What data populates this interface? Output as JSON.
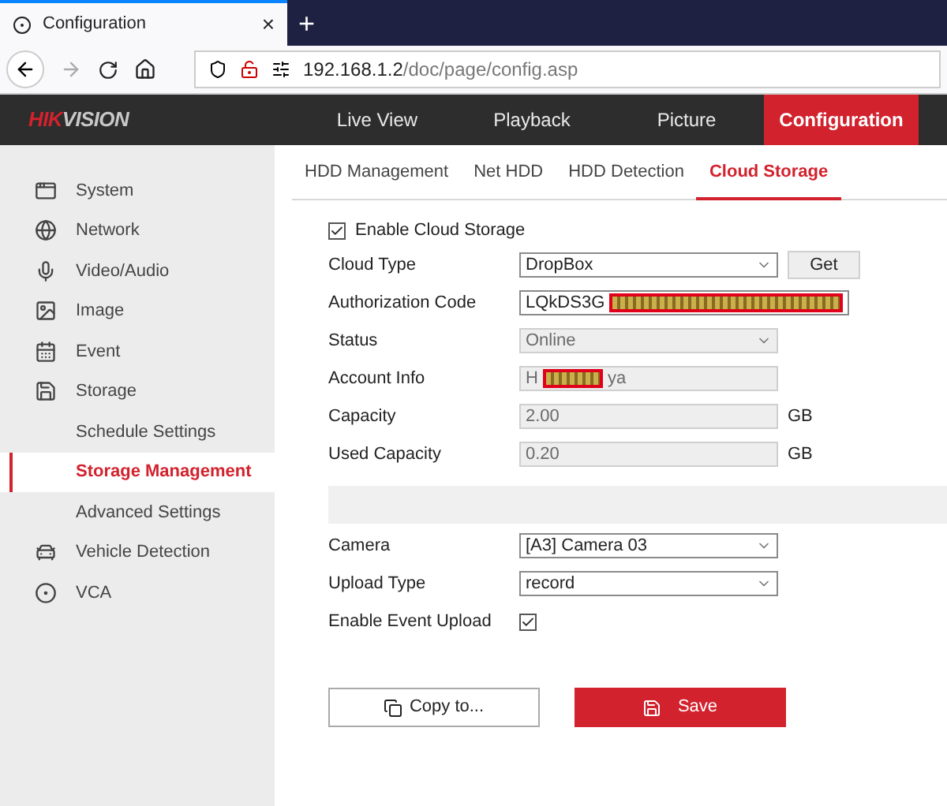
{
  "browser": {
    "tab_title": "Configuration",
    "tab_close": "×",
    "new_tab": "+",
    "url_host": "192.168.1.2",
    "url_path": "/doc/page/config.asp"
  },
  "header": {
    "logo_accent": "HIK",
    "logo_rest": "VISION",
    "nav": [
      {
        "label": "Live View",
        "selected": false
      },
      {
        "label": "Playback",
        "selected": false
      },
      {
        "label": "Picture",
        "selected": false
      },
      {
        "label": "Configuration",
        "selected": true
      }
    ]
  },
  "sidebar": {
    "items": [
      {
        "label": "System",
        "selected": false
      },
      {
        "label": "Network",
        "selected": false
      },
      {
        "label": "Video/Audio",
        "selected": false
      },
      {
        "label": "Image",
        "selected": false
      },
      {
        "label": "Event",
        "selected": false
      },
      {
        "label": "Storage",
        "selected": false,
        "children": [
          {
            "label": "Schedule Settings",
            "selected": false
          },
          {
            "label": "Storage Management",
            "selected": true
          },
          {
            "label": "Advanced Settings",
            "selected": false
          }
        ]
      },
      {
        "label": "Vehicle Detection",
        "selected": false
      },
      {
        "label": "VCA",
        "selected": false
      }
    ]
  },
  "subtabs": [
    {
      "label": "HDD Management",
      "selected": false
    },
    {
      "label": "Net HDD",
      "selected": false
    },
    {
      "label": "HDD Detection",
      "selected": false
    },
    {
      "label": "Cloud Storage",
      "selected": true
    }
  ],
  "enable_cloud_storage": {
    "label": "Enable Cloud Storage",
    "checked": true
  },
  "cloud_fields": [
    {
      "kind": "select",
      "label": "Cloud Type",
      "value": "DropBox",
      "disabled": false,
      "button": "Get"
    },
    {
      "kind": "text",
      "label": "Authorization Code",
      "value": "LQkDS3G",
      "disabled": false,
      "redacted": true
    },
    {
      "kind": "select",
      "label": "Status",
      "value": "Online",
      "disabled": true
    },
    {
      "kind": "text",
      "label": "Account Info",
      "value": "H",
      "value_end": "ya",
      "disabled": true,
      "redacted": true
    },
    {
      "kind": "text",
      "label": "Capacity",
      "value": "2.00",
      "disabled": true,
      "unit": "GB"
    },
    {
      "kind": "text",
      "label": "Used Capacity",
      "value": "0.20",
      "disabled": true,
      "unit": "GB"
    }
  ],
  "upload_fields": [
    {
      "kind": "select",
      "label": "Camera",
      "value": "[A3] Camera 03",
      "disabled": false
    },
    {
      "kind": "select",
      "label": "Upload Type",
      "value": "record",
      "disabled": false
    },
    {
      "kind": "checkbox",
      "label": "Enable Event Upload",
      "checked": true
    }
  ],
  "buttons": {
    "copy": "Copy to...",
    "save": "Save"
  }
}
